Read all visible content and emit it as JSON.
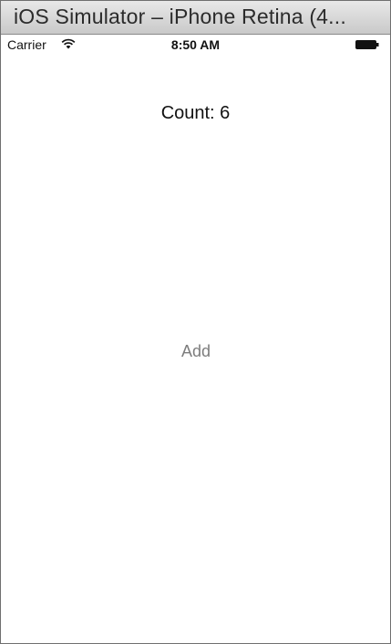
{
  "window": {
    "title": "iOS Simulator – iPhone Retina (4..."
  },
  "status_bar": {
    "carrier": "Carrier",
    "time": "8:50 AM",
    "wifi_icon": "wifi-icon",
    "battery_icon": "battery-icon",
    "battery_level": 1.0
  },
  "main": {
    "count_label": "Count: 6",
    "add_button_label": "Add"
  },
  "colors": {
    "button_text": "#7d7d7d",
    "label_text": "#111111"
  }
}
